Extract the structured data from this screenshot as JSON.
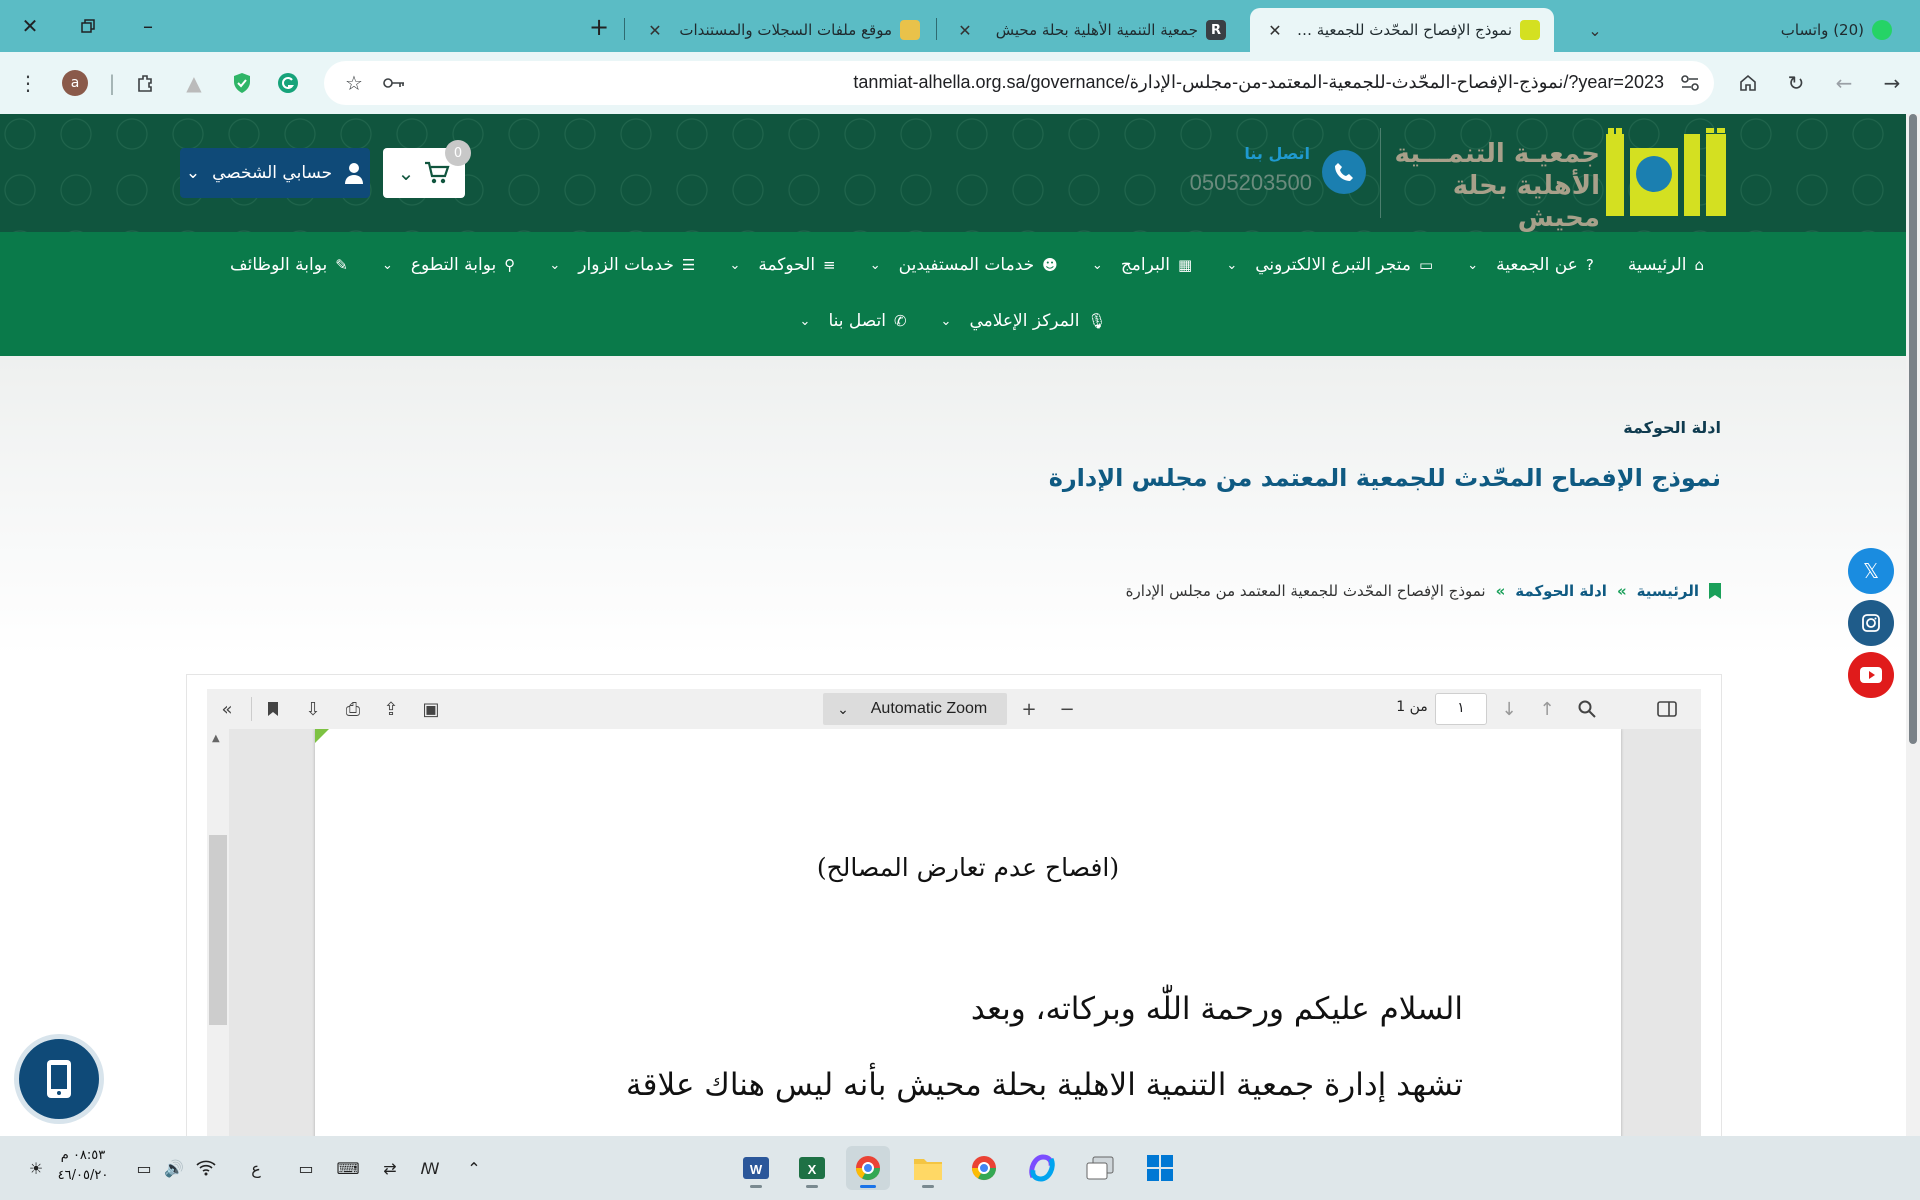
{
  "browser": {
    "tabs": [
      {
        "title": "(20) واتساب",
        "active": false
      },
      {
        "title": "نموذج الإفصاح المحّدث للجمعية المعتمد من مجلس الإدارة",
        "active": true
      },
      {
        "title": "جمعية التنمية الأهلية بحلة محيش",
        "active": false
      },
      {
        "title": "موقع ملفات السجلات والمستندات",
        "active": false
      }
    ],
    "url": "tanmiat-alhella.org.sa/governance/نموذج-الإفصاح-المحّدث-للجمعية-المعتمد-من-مجلس-الإدارة/?year=2023",
    "profile_initial": "a"
  },
  "site": {
    "logo_line1": "جمعيـة التنمـــية",
    "logo_line2": "الأهلية بحلة محيش",
    "contact_label": "اتصل بنا",
    "contact_phone": "0505203500",
    "cart_count": "0",
    "account_label": "حسابي الشخصي",
    "colors": {
      "header": "#10553e",
      "nav": "#0a7a4a",
      "logo_yellow": "#d4e021",
      "title_blue": "#0f5a82",
      "accent_green": "#1aa05a"
    }
  },
  "nav": {
    "row1": [
      {
        "label": "الرئيسية",
        "icon": "home-icon",
        "caret": false
      },
      {
        "label": "عن الجمعية",
        "icon": "question-icon",
        "caret": true
      },
      {
        "label": "متجر التبرع الالكتروني",
        "icon": "card-icon",
        "caret": true
      },
      {
        "label": "البرامج",
        "icon": "calendar-icon",
        "caret": true
      },
      {
        "label": "خدمات المستفيدين",
        "icon": "users-icon",
        "caret": true
      },
      {
        "label": "الحوكمة",
        "icon": "list-icon",
        "caret": true
      },
      {
        "label": "خدمات الزوار",
        "icon": "server-icon",
        "caret": true
      },
      {
        "label": "بوابة التطوع",
        "icon": "person-icon",
        "caret": true
      },
      {
        "label": "بوابة الوظائف",
        "icon": "edit-icon",
        "caret": false
      }
    ],
    "row2": [
      {
        "label": "المركز الإعلامي",
        "icon": "mic-icon",
        "caret": true
      },
      {
        "label": "اتصل بنا",
        "icon": "phone-icon",
        "caret": true
      }
    ]
  },
  "hero": {
    "subtitle": "ادلة الحوكمة",
    "title": "نموذج الإفصاح المحّدث للجمعية المعتمد من مجلس الإدارة",
    "breadcrumb": {
      "home": "الرئيسية",
      "section": "ادلة الحوكمة",
      "current": "نموذج الإفصاح المحّدث للجمعية المعتمد من مجلس الإدارة",
      "sep": "»"
    }
  },
  "social": [
    "x-icon",
    "instagram-icon",
    "youtube-icon"
  ],
  "pdf": {
    "zoom": "Automatic Zoom",
    "page_number": "١",
    "page_of": "من 1",
    "heading": "(افصاح عدم تعارض المصالح)",
    "line1": "السلام عليكم ورحمة اللّٰه وبركاته، وبعد",
    "line2": "تشهد إدارة جمعية التنمية الاهلية بحلة محيش بأنه ليس هناك علاقة"
  },
  "taskbar": {
    "clock_time": "٠٨:٥٣ م",
    "clock_date": "٤٦/٠٥/٢٠",
    "lang": "ع",
    "apps": [
      "word-icon",
      "excel-icon",
      "chrome-profile-icon",
      "file-explorer-icon",
      "chrome-icon",
      "copilot-icon",
      "taskview-icon",
      "start-icon"
    ]
  }
}
